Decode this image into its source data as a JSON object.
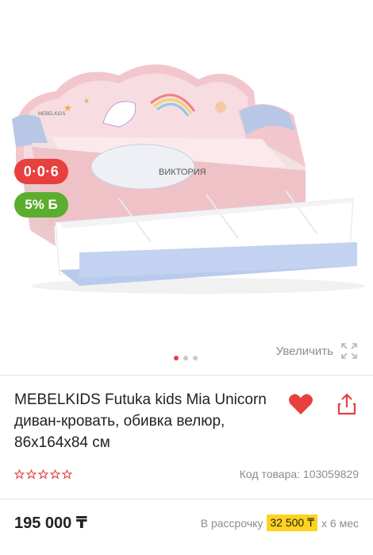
{
  "badges": {
    "installment": "0·0·6",
    "bonus": "5% Б"
  },
  "gallery": {
    "zoom_label": "Увеличить",
    "slides": 3,
    "active_slide": 1,
    "image_labels": {
      "small_plate": "MEBELKIDS",
      "name_plate": "ВИКТОРИЯ"
    }
  },
  "product": {
    "title": "MEBELKIDS Futuka kids Mia Unicorn диван-кровать, обивка велюр, 86x164x84 см",
    "sku_label": "Код товара: 103059829",
    "rating": 0,
    "price": "195 000 ₸",
    "installment_prefix": "В рассрочку",
    "installment_amount": "32 500 ₸",
    "installment_suffix": "х 6 мес"
  },
  "colors": {
    "accent_red": "#e8403f",
    "bonus_green": "#5cad2e",
    "installment_yellow": "#ffd21e"
  },
  "icons": {
    "favorite": "heart-icon",
    "share": "share-icon",
    "zoom": "expand-icon",
    "rating": "star-outline-icon"
  }
}
